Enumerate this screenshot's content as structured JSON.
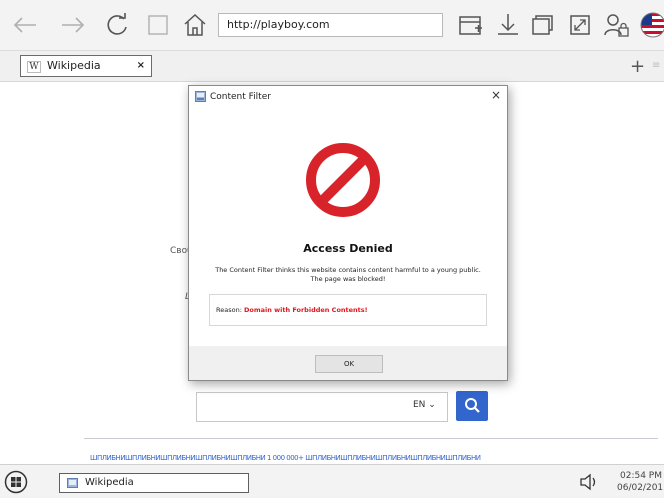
{
  "browser": {
    "url": "http://playboy.com",
    "tab": {
      "title": "Wikipedia",
      "close": "×"
    },
    "new_tab": "+"
  },
  "page": {
    "text_fragment_1": "Своб",
    "text_fragment_2": "L",
    "language_selector": "EN",
    "language_links_text": "ШПЛИБНИШПЛИБНИШПЛИБНИШПЛИБНИШПЛИБНИ 1 000 000+ ШПЛИБНИШПЛИБНИШПЛИБНИШПЛИБНИШПЛИБНИ"
  },
  "dialog": {
    "title": "Content Filter",
    "close": "×",
    "heading": "Access Denied",
    "message_line1": "The Content Filter thinks this website contains content harmful to a young public.",
    "message_line2": "The page was blocked!",
    "reason_label": "Reason:",
    "reason_value": "Domain with Forbidden Contents!",
    "ok_label": "OK",
    "deny_color": "#d8232a"
  },
  "taskbar": {
    "task_label": "Wikipedia",
    "time": "02:54 PM",
    "date": "06/02/201"
  },
  "colors": {
    "accent": "#3366cc",
    "reason": "#e0161d"
  }
}
